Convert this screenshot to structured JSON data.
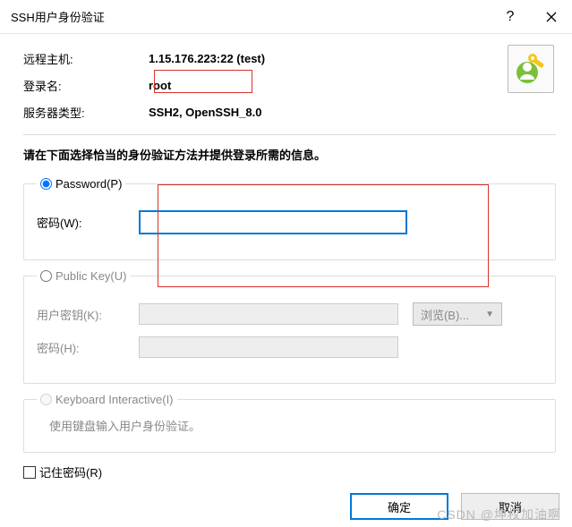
{
  "window": {
    "title": "SSH用户身份验证"
  },
  "info": {
    "remote_host_label": "远程主机:",
    "remote_host_value": "1.15.176.223:22 (test)",
    "login_label": "登录名:",
    "login_value": "root",
    "server_type_label": "服务器类型:",
    "server_type_value": "SSH2, OpenSSH_8.0"
  },
  "instruction": "请在下面选择恰当的身份验证方法并提供登录所需的信息。",
  "methods": {
    "password": {
      "legend": "Password(P)",
      "pw_label": "密码(W):",
      "pw_value": ""
    },
    "publickey": {
      "legend": "Public Key(U)",
      "userkey_label": "用户密钥(K):",
      "browse_label": "浏览(B)...",
      "pw_label": "密码(H):"
    },
    "keyboard": {
      "legend": "Keyboard Interactive(I)",
      "hint": "使用键盘输入用户身份验证。"
    }
  },
  "remember_label": "记住密码(R)",
  "buttons": {
    "ok": "确定",
    "cancel": "取消"
  },
  "watermark": "CSDN @坤权加油啊"
}
